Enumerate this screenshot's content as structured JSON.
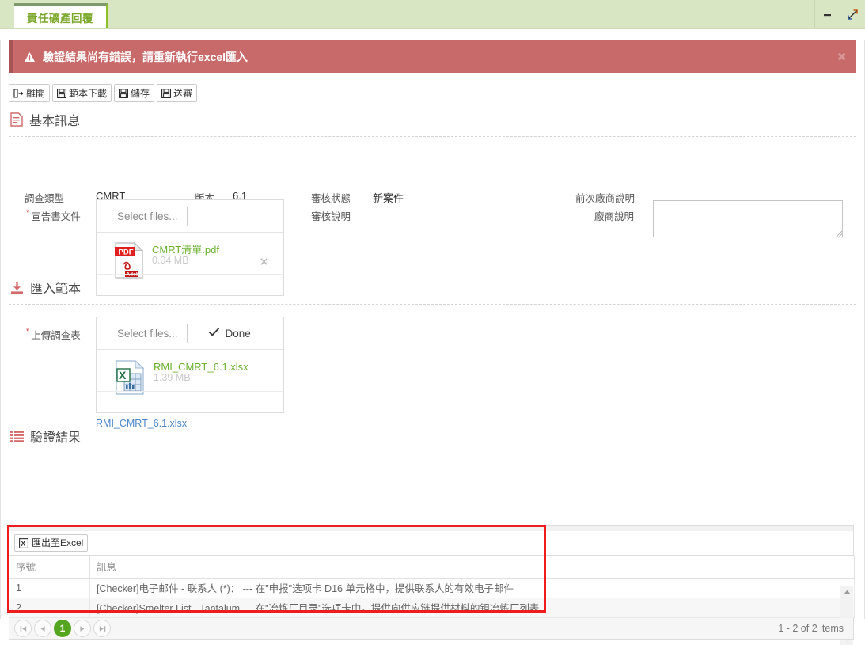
{
  "window": {
    "tab_label": "責任礦產回覆",
    "minimize_label": "−",
    "expand_label": "⤢"
  },
  "alert": {
    "icon": "warning-triangle-icon",
    "message": "驗證結果尚有錯誤，請重新執行excel匯入",
    "close_label": "✖",
    "bg_color": "#c96a6a"
  },
  "toolbar": {
    "buttons": [
      {
        "label": "離開",
        "icon": "exit-icon"
      },
      {
        "label": "範本下載",
        "icon": "save-disk-icon"
      },
      {
        "label": "儲存",
        "icon": "save-disk-icon"
      },
      {
        "label": "送審",
        "icon": "save-disk-icon"
      }
    ]
  },
  "sections": {
    "basic_info": {
      "title": "基本訊息",
      "icon": "document-icon"
    },
    "import_template": {
      "title": "匯入範本",
      "icon": "download-icon"
    },
    "validation_result": {
      "title": "驗證結果",
      "icon": "list-icon"
    }
  },
  "basic_info": {
    "survey_type_label": "調查類型",
    "survey_type_value": "CMRT",
    "version_label": "版本",
    "version_value": "6.1",
    "declaration_label": "宣告書文件",
    "review_status_label": "審核狀態",
    "review_status_value": "新案件",
    "review_note_label": "審核說明",
    "review_note_value": "",
    "prev_vendor_note_label": "前次廠商說明",
    "prev_vendor_note_value": "",
    "vendor_note_label": "廠商說明",
    "vendor_note_value": "",
    "upload": {
      "select_files_label": "Select files...",
      "file_name": "CMRT清單.pdf",
      "file_size": "0.04 MB",
      "remove_label": "✕",
      "file_icon": "pdf-file-icon"
    }
  },
  "import_template": {
    "upload_survey_label": "上傳調查表",
    "upload": {
      "select_files_label": "Select files...",
      "status_label": "Done",
      "status_icon": "check-icon",
      "file_name": "RMI_CMRT_6.1.xlsx",
      "file_size": "1.39 MB",
      "file_icon": "excel-file-icon"
    },
    "download_link": "RMI_CMRT_6.1.xlsx"
  },
  "validation_grid": {
    "export_button": {
      "label": "匯出至Excel",
      "icon": "excel-icon"
    },
    "columns": [
      "序號",
      "訊息",
      ""
    ],
    "rows": [
      {
        "seq": "1",
        "message": "[Checker]电子邮件 - 联系人 (*)： --- 在\"申报\"选项卡 D16 单元格中，提供联系人的有效电子邮件"
      },
      {
        "seq": "2",
        "message": "[Checker]Smelter List - Tantalum --- 在\"冶炼厂目录\"选项卡中，提供向供应链提供材料的钽冶炼厂列表"
      }
    ],
    "pager": {
      "first_label": "⏮",
      "prev_label": "◀",
      "current_page": "1",
      "next_label": "▶",
      "last_label": "⏭",
      "info": "1 - 2 of 2 items"
    },
    "highlight_color": "#ee1c1c"
  }
}
